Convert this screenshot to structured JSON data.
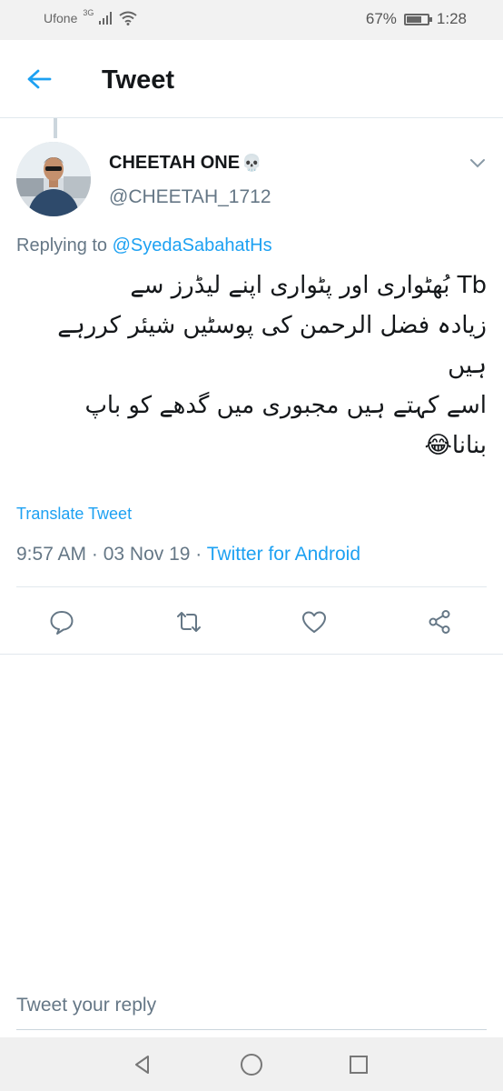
{
  "status_bar": {
    "carrier": "Ufone",
    "network": "3G",
    "battery": "67%",
    "battery_level": 0.67,
    "time": "1:28"
  },
  "header": {
    "title": "Tweet"
  },
  "tweet": {
    "author_name": "CHEETAH ONE",
    "author_emoji": "💀",
    "author_handle": "@CHEETAH_1712",
    "replying_prefix": "Replying to ",
    "replying_to": "@SyedaSabahatHs",
    "body_lines": [
      "Tb بُھٹواری اور پٹواری اپنے لیڈرز سے",
      "زیادہ فضل الرحمن کی پوسٹیں شیئر کررہے",
      "ہیں",
      "اسے کہتے ہیں مجبوری میں گدھے کو باپ",
      "بنانا😂"
    ],
    "translate_label": "Translate Tweet",
    "time": "9:57 AM",
    "date": "03 Nov 19",
    "separator": " · ",
    "source": "Twitter for Android"
  },
  "actions": {
    "reply_icon": "comment-icon",
    "retweet_icon": "retweet-icon",
    "like_icon": "heart-icon",
    "share_icon": "share-icon"
  },
  "reply_bar": {
    "placeholder": "Tweet your reply"
  },
  "colors": {
    "accent": "#1da1f2",
    "secondary_text": "#657786",
    "icon_gray": "#657786"
  }
}
